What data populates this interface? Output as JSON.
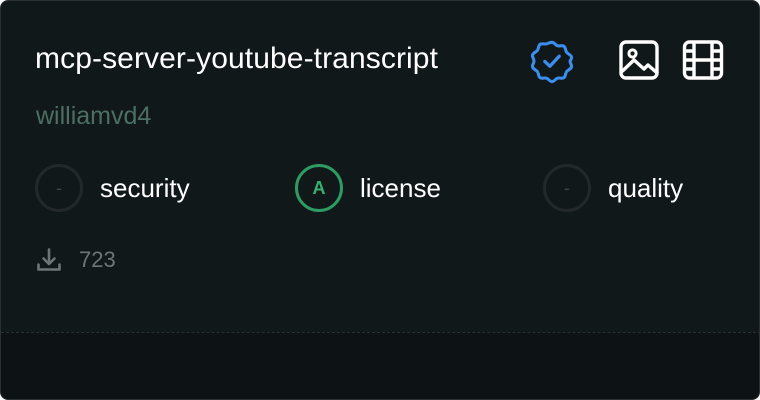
{
  "server": {
    "name": "mcp-server-youtube-transcript",
    "author": "williamvd4"
  },
  "icons": {
    "verified": "verified-badge-icon",
    "image": "image-icon",
    "video": "film-icon",
    "download": "download-icon"
  },
  "metrics": {
    "security": {
      "score": "-",
      "label": "security"
    },
    "license": {
      "score": "A",
      "label": "license"
    },
    "quality": {
      "score": "-",
      "label": "quality"
    }
  },
  "stats": {
    "downloads": "723"
  },
  "colors": {
    "card_background": "#111819",
    "author_text": "#4c6f62",
    "verified_blue": "#3b8ef0",
    "grade_a_green": "#2e9b63",
    "muted": "#6d7577"
  }
}
